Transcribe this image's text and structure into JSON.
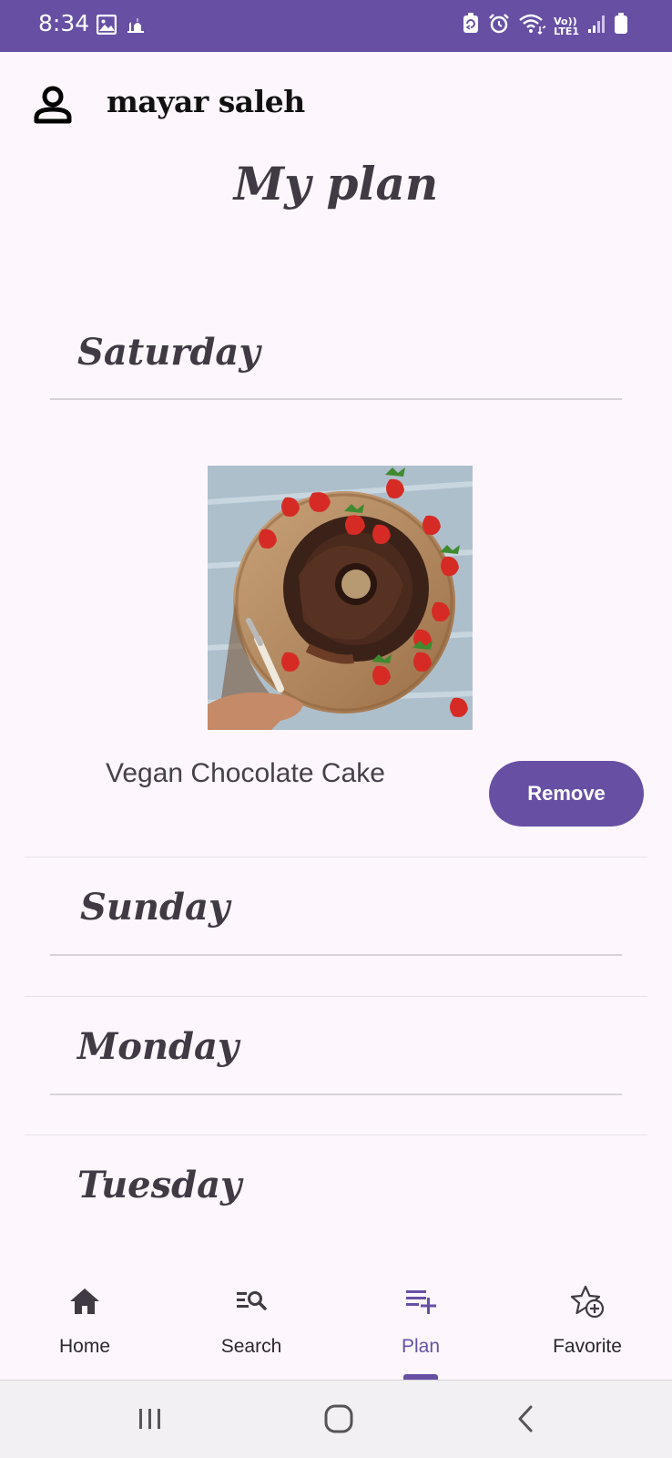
{
  "status_bar": {
    "time": "8:34",
    "background_color": "#6750a4",
    "left_icons": [
      "gallery-icon",
      "mosque-icon"
    ],
    "right_icons": [
      "battery-saver-icon",
      "alarm-icon",
      "wifi-icon",
      "volte-icon",
      "signal-icon",
      "battery-icon"
    ],
    "volte_top": "Vo))",
    "volte_bottom": "LTE1"
  },
  "header": {
    "profile_icon": "person-icon",
    "user_name": "mayar saleh"
  },
  "page": {
    "title": "My plan"
  },
  "days": [
    {
      "name": "Saturday",
      "meals": [
        {
          "name": "Vegan Chocolate Cake",
          "image": "chocolate-bundt-cake-with-strawberries",
          "remove_label": "Remove"
        }
      ]
    },
    {
      "name": "Sunday",
      "meals": []
    },
    {
      "name": "Monday",
      "meals": []
    },
    {
      "name": "Tuesday",
      "meals": []
    }
  ],
  "bottom_nav": {
    "items": [
      {
        "label": "Home",
        "icon": "home-icon"
      },
      {
        "label": "Search",
        "icon": "search-list-icon"
      },
      {
        "label": "Plan",
        "icon": "playlist-add-icon",
        "active": true
      },
      {
        "label": "Favorite",
        "icon": "star-add-icon"
      }
    ],
    "active_color": "#6750a4"
  },
  "system_nav": {
    "buttons": [
      "recent-apps-icon",
      "home-button-icon",
      "back-icon"
    ]
  },
  "colors": {
    "background": "#fdf7fd",
    "accent": "#6750a4",
    "title_text": "#3f3a44"
  }
}
